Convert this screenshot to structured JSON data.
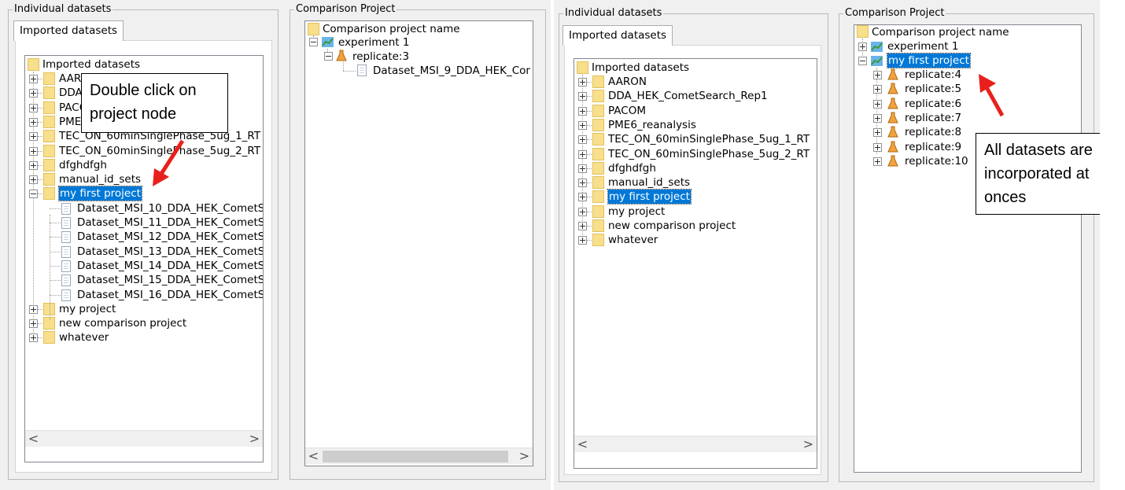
{
  "left_shot": {
    "individual_datasets": {
      "legend": "Individual datasets",
      "tab_label": "Imported datasets",
      "root_label": "Imported datasets",
      "items": [
        {
          "label": "AARON"
        },
        {
          "label": "DDA_HEK_CometSearch_Rep1"
        },
        {
          "label": "PACOM"
        },
        {
          "label": "PME6_reanalysis"
        },
        {
          "label": "TEC_ON_60minSinglePhase_5ug_1_RT"
        },
        {
          "label": "TEC_ON_60minSinglePhase_5ug_2_RT"
        },
        {
          "label": "dfghdfgh"
        },
        {
          "label": "manual_id_sets"
        },
        {
          "label": "my first project",
          "selected": true
        },
        {
          "label": "Dataset_MSI_10_DDA_HEK_CometS"
        },
        {
          "label": "Dataset_MSI_11_DDA_HEK_CometS"
        },
        {
          "label": "Dataset_MSI_12_DDA_HEK_CometS"
        },
        {
          "label": "Dataset_MSI_13_DDA_HEK_CometS"
        },
        {
          "label": "Dataset_MSI_14_DDA_HEK_CometS"
        },
        {
          "label": "Dataset_MSI_15_DDA_HEK_CometS"
        },
        {
          "label": "Dataset_MSI_16_DDA_HEK_CometS"
        },
        {
          "label": "my project"
        },
        {
          "label": "new comparison project"
        },
        {
          "label": "whatever"
        }
      ],
      "scroll_left": "<",
      "scroll_right": ">"
    },
    "comparison_project": {
      "legend": "Comparison Project",
      "root_label": "Comparison project name",
      "experiment_label": "experiment 1",
      "replicate_label": "replicate:3",
      "dataset_label": "Dataset_MSI_9_DDA_HEK_Cor",
      "scroll_left": "<",
      "scroll_right": ">"
    },
    "callout": {
      "line1": "Double click on",
      "line2": "project node"
    }
  },
  "right_shot": {
    "individual_datasets": {
      "legend": "Individual datasets",
      "tab_label": "Imported datasets",
      "root_label": "Imported datasets",
      "items": [
        {
          "label": "AARON"
        },
        {
          "label": "DDA_HEK_CometSearch_Rep1"
        },
        {
          "label": "PACOM"
        },
        {
          "label": "PME6_reanalysis"
        },
        {
          "label": "TEC_ON_60minSinglePhase_5ug_1_RT"
        },
        {
          "label": "TEC_ON_60minSinglePhase_5ug_2_RT"
        },
        {
          "label": "dfghdfgh"
        },
        {
          "label": "manual_id_sets"
        },
        {
          "label": "my first project",
          "selected": true
        },
        {
          "label": "my project"
        },
        {
          "label": "new comparison project"
        },
        {
          "label": "whatever"
        }
      ],
      "scroll_left": "<",
      "scroll_right": ">"
    },
    "comparison_project": {
      "legend": "Comparison Project",
      "root_label": "Comparison project name",
      "experiment_label": "experiment 1",
      "project_label": "my first project",
      "replicates": [
        "replicate:4",
        "replicate:5",
        "replicate:6",
        "replicate:7",
        "replicate:8",
        "replicate:9",
        "replicate:10"
      ]
    },
    "callout": {
      "line1": "All datasets are",
      "line2": "incorporated at",
      "line3": "onces"
    }
  },
  "colors": {
    "selection": "#0078d7",
    "arrow": "#e8201c",
    "folder": "#f7df8c",
    "window_bg": "#f0f0f0"
  },
  "icons": {
    "folder": "folder-icon",
    "dataset": "dataset-icon",
    "replicate": "flask-icon",
    "experiment": "chart-icon"
  }
}
